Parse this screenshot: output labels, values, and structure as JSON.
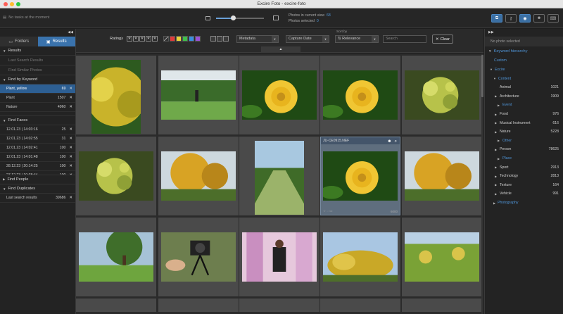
{
  "window": {
    "title": "Excire Foto - excire-foto",
    "dots": [
      "#fe5f57",
      "#febc2e",
      "#28c840"
    ]
  },
  "topbar": {
    "task_status": "No tasks at the moment",
    "zoom_level": 0.35,
    "photos_in_view_label": "Photos in current view",
    "photos_in_view_value": "68",
    "photos_selected_label": "Photos selected",
    "photos_selected_value": "0",
    "buttons": [
      "duplicates-icon",
      "key-icon",
      "globe-icon",
      "faces-icon",
      "keyboard-icon"
    ]
  },
  "left": {
    "tabs": {
      "folders": "Folders",
      "results": "Results"
    },
    "results_header": "Results",
    "last_search": "Last Search Results",
    "find_similar": "Find Similar Photos",
    "find_by_keyword": "Find by Keyword",
    "keywords": [
      {
        "label": "Plant, yellow",
        "count": "69"
      },
      {
        "label": "Plant",
        "count": "1507"
      },
      {
        "label": "Nature",
        "count": "4960"
      }
    ],
    "find_faces": "Find Faces",
    "faces": [
      {
        "label": "12.01.23 | 14:03:16",
        "count": "25"
      },
      {
        "label": "12.01.23 | 14:02:55",
        "count": "31"
      },
      {
        "label": "12.01.23 | 14:02:41",
        "count": "100"
      },
      {
        "label": "12.01.23 | 14:01:48",
        "count": "100"
      },
      {
        "label": "28.12.23 | 20:14:25",
        "count": "100"
      },
      {
        "label": "27.12.23 | 10:38:44",
        "count": "100"
      }
    ],
    "find_people": "Find People",
    "find_duplicates": "Find Duplicates",
    "dup_label": "Last search results",
    "dup_count": "39686"
  },
  "filters": {
    "rating_label": "Rating",
    "rating_op": "≥",
    "colors": [
      "#e03a3a",
      "#e8d23a",
      "#3fbf4a",
      "#3a8fe0",
      "#9a52d6"
    ],
    "metadata": "Metadata",
    "capture_date": "Capture Date",
    "sort_by_label": "Sort by",
    "sort_value": "Relevance",
    "search_placeholder": "Search",
    "clear_label": "Clear"
  },
  "grid": {
    "selected_filename": "JU-CE0915.NEF",
    "selected_meta": "6000"
  },
  "right": {
    "no_photo": "No photo selected",
    "keyword_hierarchy": "Keyword hierarchy",
    "custom": "Custom",
    "excire": "Excire",
    "content": "Content",
    "items": [
      {
        "label": "Animal",
        "count": "1021",
        "blue": false,
        "tri": false
      },
      {
        "label": "Architecture",
        "count": "1909",
        "blue": false,
        "tri": true
      },
      {
        "label": "Event",
        "count": "",
        "blue": true,
        "tri": true
      },
      {
        "label": "Food",
        "count": "976",
        "blue": false,
        "tri": true
      },
      {
        "label": "Musical Instrument",
        "count": "616",
        "blue": false,
        "tri": true
      },
      {
        "label": "Nature",
        "count": "5228",
        "blue": false,
        "tri": true
      },
      {
        "label": "Other",
        "count": "",
        "blue": true,
        "tri": true
      },
      {
        "label": "Person",
        "count": "78625",
        "blue": false,
        "tri": true
      },
      {
        "label": "Place",
        "count": "",
        "blue": true,
        "tri": true
      },
      {
        "label": "Sport",
        "count": "2913",
        "blue": false,
        "tri": true
      },
      {
        "label": "Technology",
        "count": "2813",
        "blue": false,
        "tri": true
      },
      {
        "label": "Texture",
        "count": "164",
        "blue": false,
        "tri": true
      },
      {
        "label": "Vehicle",
        "count": "991",
        "blue": false,
        "tri": true
      }
    ],
    "photography": "Photography"
  }
}
